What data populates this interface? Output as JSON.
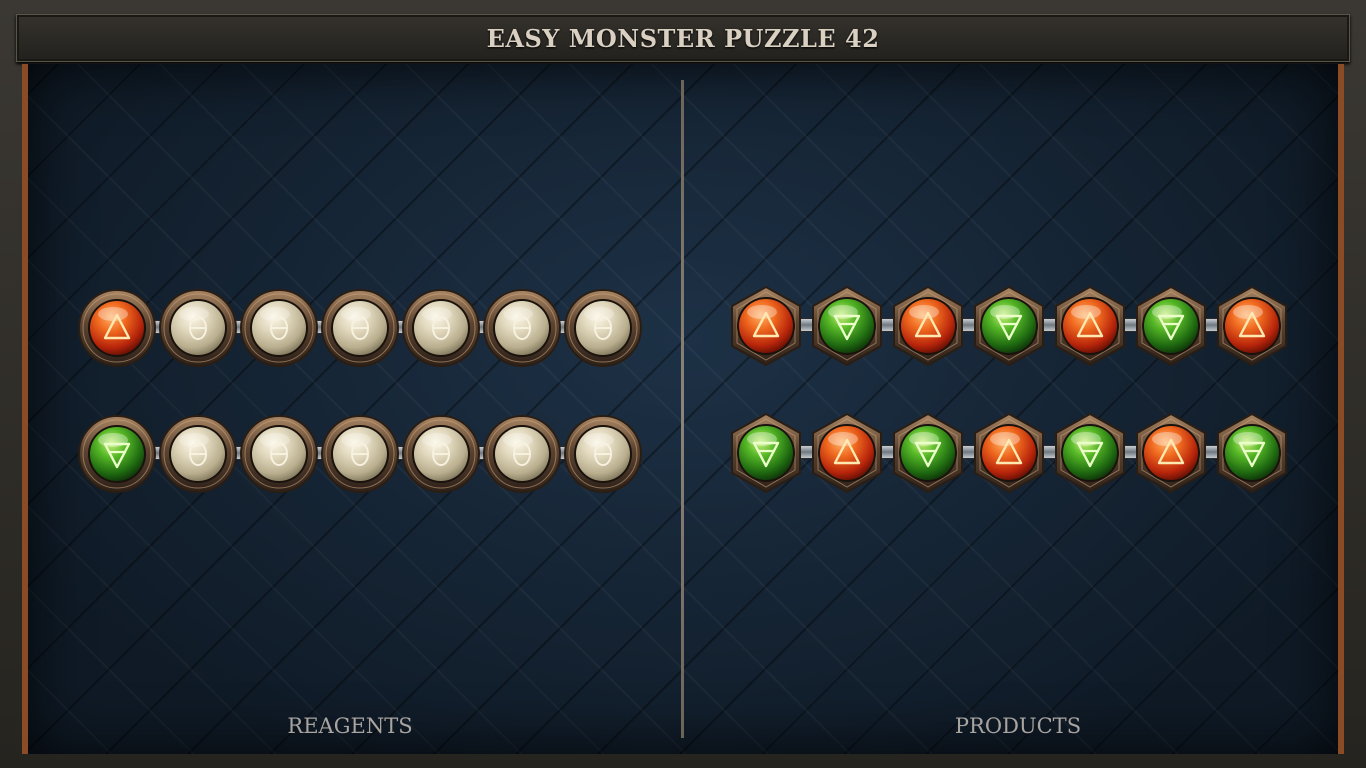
{
  "title": "EASY MONSTER PUZZLE 42",
  "panels": {
    "reagents_label": "REAGENTS",
    "products_label": "PRODUCTS"
  },
  "reagents": [
    [
      "fire",
      "empty",
      "empty",
      "empty",
      "empty",
      "empty",
      "empty"
    ],
    [
      "earth",
      "empty",
      "empty",
      "empty",
      "empty",
      "empty",
      "empty"
    ]
  ],
  "products": [
    [
      "fire",
      "earth",
      "fire",
      "earth",
      "fire",
      "earth",
      "fire"
    ],
    [
      "earth",
      "fire",
      "earth",
      "fire",
      "earth",
      "fire",
      "earth"
    ]
  ],
  "colors": {
    "fire": "#e8531a",
    "earth": "#3fa21c",
    "empty": "#ddd5bd",
    "bronze": "#7a5a3c"
  },
  "icons": {
    "fire": "alchemy-fire-triangle-icon",
    "earth": "alchemy-earth-triangle-icon",
    "empty": "theta-slot-icon"
  }
}
